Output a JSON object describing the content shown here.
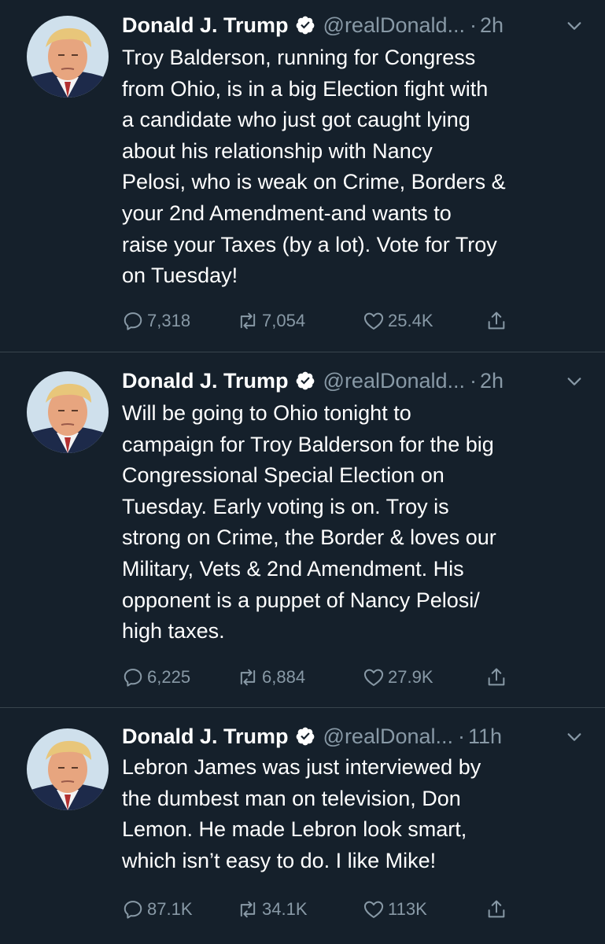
{
  "tweets": [
    {
      "name": "Donald J. Trump",
      "handle": "@realDonald...",
      "separator": "·",
      "time": "2h",
      "text": "Troy Balderson, running for Congress\nfrom Ohio, is in a big Election fight with\na candidate who just got caught lying\nabout his relationship with Nancy\nPelosi, who is weak on Crime, Borders &\nyour 2nd Amendment-and wants to\nraise your Taxes (by a lot). Vote for Troy\non Tuesday!",
      "replies": "7,318",
      "retweets": "7,054",
      "likes": "25.4K"
    },
    {
      "name": "Donald J. Trump",
      "handle": "@realDonald...",
      "separator": "·",
      "time": "2h",
      "text": "Will be going to Ohio tonight to\ncampaign for Troy Balderson for the big\nCongressional Special Election on\nTuesday. Early voting is on. Troy is\nstrong on Crime, the Border & loves our\nMilitary, Vets & 2nd Amendment. His\nopponent is a puppet of Nancy Pelosi/\nhigh taxes.",
      "replies": "6,225",
      "retweets": "6,884",
      "likes": "27.9K"
    },
    {
      "name": "Donald J. Trump",
      "handle": "@realDonal...",
      "separator": "·",
      "time": "11h",
      "text": "Lebron James was just interviewed by\nthe dumbest man on television, Don\nLemon. He made Lebron look smart,\nwhich isn’t easy to do. I like Mike!",
      "replies": "87.1K",
      "retweets": "34.1K",
      "likes": "113K"
    }
  ],
  "colors": {
    "background": "#15202b",
    "text_primary": "#ffffff",
    "text_secondary": "#8899a6",
    "divider": "#38444d",
    "verified_badge": "#ffffff"
  },
  "icons": [
    "avatar",
    "verified-badge-icon",
    "chevron-down-icon",
    "reply-icon",
    "retweet-icon",
    "like-icon",
    "share-icon"
  ]
}
